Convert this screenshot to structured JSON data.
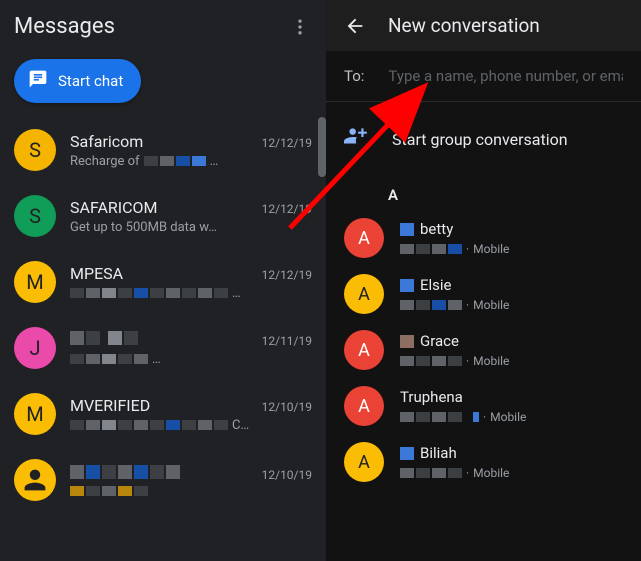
{
  "left": {
    "title": "Messages",
    "start_chat": "Start chat",
    "threads": [
      {
        "avatar_letter": "S",
        "avatar_color": "orange",
        "name": "Safaricom",
        "date": "12/12/19",
        "snippet": "Recharge of",
        "snippet_suffix": "…"
      },
      {
        "avatar_letter": "S",
        "avatar_color": "green",
        "name": "SAFARICOM",
        "date": "12/12/19",
        "snippet": "Get up to 500MB data w…",
        "snippet_suffix": ""
      },
      {
        "avatar_letter": "M",
        "avatar_color": "yellow",
        "name": "MPESA",
        "date": "12/12/19",
        "snippet": "",
        "snippet_suffix": "…"
      },
      {
        "avatar_letter": "J",
        "avatar_color": "pink",
        "name": "",
        "date": "12/11/19",
        "snippet": "",
        "snippet_suffix": "…"
      },
      {
        "avatar_letter": "M",
        "avatar_color": "yellow",
        "name": "MVERIFIED",
        "date": "12/10/19",
        "snippet": "",
        "snippet_suffix": "C…"
      },
      {
        "avatar_letter": "",
        "avatar_color": "default",
        "name": "",
        "date": "12/10/19",
        "snippet": "",
        "snippet_suffix": ""
      }
    ]
  },
  "right": {
    "title": "New conversation",
    "to_label": "To:",
    "to_placeholder": "Type a name, phone number, or email",
    "group_label": "Start group conversation",
    "section_letter": "A",
    "mobile_label": "Mobile",
    "contacts": [
      {
        "letter": "A",
        "color": "red",
        "name": "betty"
      },
      {
        "letter": "A",
        "color": "amber",
        "name": "Elsie"
      },
      {
        "letter": "A",
        "color": "red",
        "name": "Grace"
      },
      {
        "letter": "A",
        "color": "red",
        "name": "Truphena"
      },
      {
        "letter": "A",
        "color": "amber",
        "name": "Biliah"
      }
    ]
  }
}
